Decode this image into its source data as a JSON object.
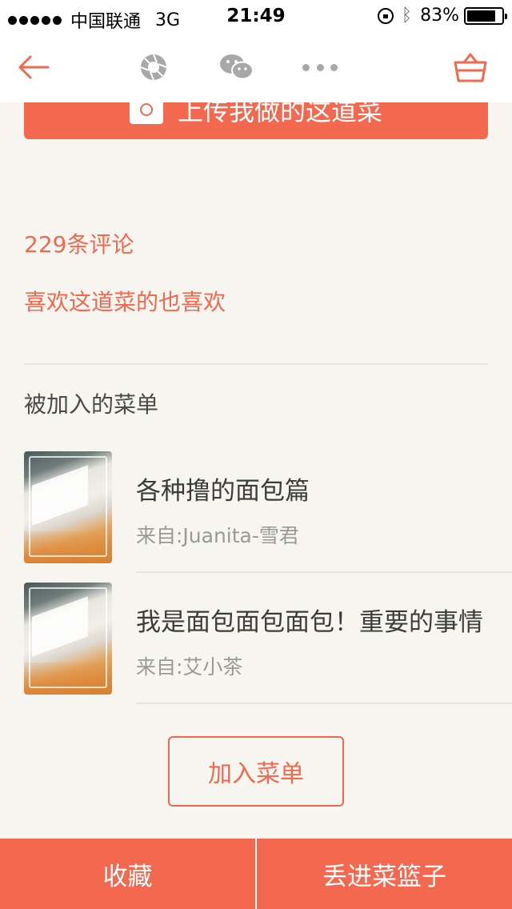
{
  "status_bar": {
    "carrier": "中国联通",
    "network": "3G",
    "time": "21:49",
    "battery_percent": "83%",
    "battery_level": 0.83
  },
  "nav": {
    "back_icon": "arrow-left-icon",
    "camera_icon": "camera-aperture-icon",
    "wechat_icon": "wechat-icon",
    "more_icon": "more-dots-icon",
    "basket_icon": "basket-icon"
  },
  "upload": {
    "label": "上传我做的这道菜"
  },
  "links": {
    "comments": "229条评论",
    "also_like": "喜欢这道菜的也喜欢"
  },
  "added_menus": {
    "title": "被加入的菜单",
    "items": [
      {
        "title": "各种撸的面包篇",
        "from": "来自:Juanita-雪君"
      },
      {
        "title": "我是面包面包面包！重要的事情",
        "from": "来自:艾小茶"
      }
    ],
    "add_button": "加入菜单"
  },
  "bottom_bar": {
    "favorite": "收藏",
    "add_to_basket": "丢进菜篮子"
  },
  "colors": {
    "accent": "#f2694f",
    "background": "#f7f5ef"
  }
}
